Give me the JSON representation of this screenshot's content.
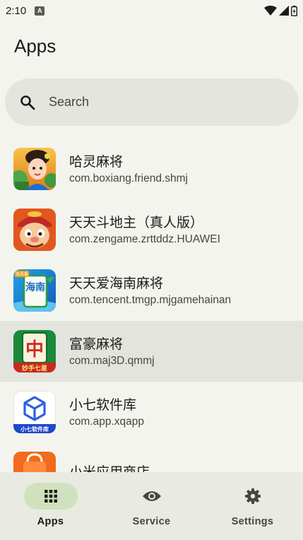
{
  "status_bar": {
    "time": "2:10",
    "badge": "A"
  },
  "header": {
    "title": "Apps"
  },
  "search": {
    "placeholder": "Search"
  },
  "apps": [
    {
      "name": "哈灵麻将",
      "package": "com.boxiang.friend.shmj"
    },
    {
      "name": "天天斗地主（真人版）",
      "package": "com.zengame.zrttddz.HUAWEI"
    },
    {
      "name": "天天爱海南麻将",
      "package": "com.tencent.tmgp.mjgamehainan"
    },
    {
      "name": "富豪麻将",
      "package": "com.maj3D.qmmj"
    },
    {
      "name": "小七软件库",
      "package": "com.app.xqapp"
    },
    {
      "name": "小米应用商店",
      "package": ""
    }
  ],
  "icon_text": {
    "hainan_tag": "天天爱",
    "hainan_tile": "海南",
    "fuhao_char": "中",
    "fuhao_banner": "妙手七星",
    "xiaoqi_banner": "小七软件库"
  },
  "nav": {
    "items": [
      {
        "label": "Apps",
        "icon": "grid-icon",
        "active": true
      },
      {
        "label": "Service",
        "icon": "eye-icon",
        "active": false
      },
      {
        "label": "Settings",
        "icon": "gear-icon",
        "active": false
      }
    ]
  },
  "colors": {
    "background": "#f3f4ee",
    "search_bg": "#e4e5de",
    "selected_row": "#e3e4dd",
    "nav_bg": "#e9eae2",
    "nav_active_pill": "#d0e2bd"
  }
}
